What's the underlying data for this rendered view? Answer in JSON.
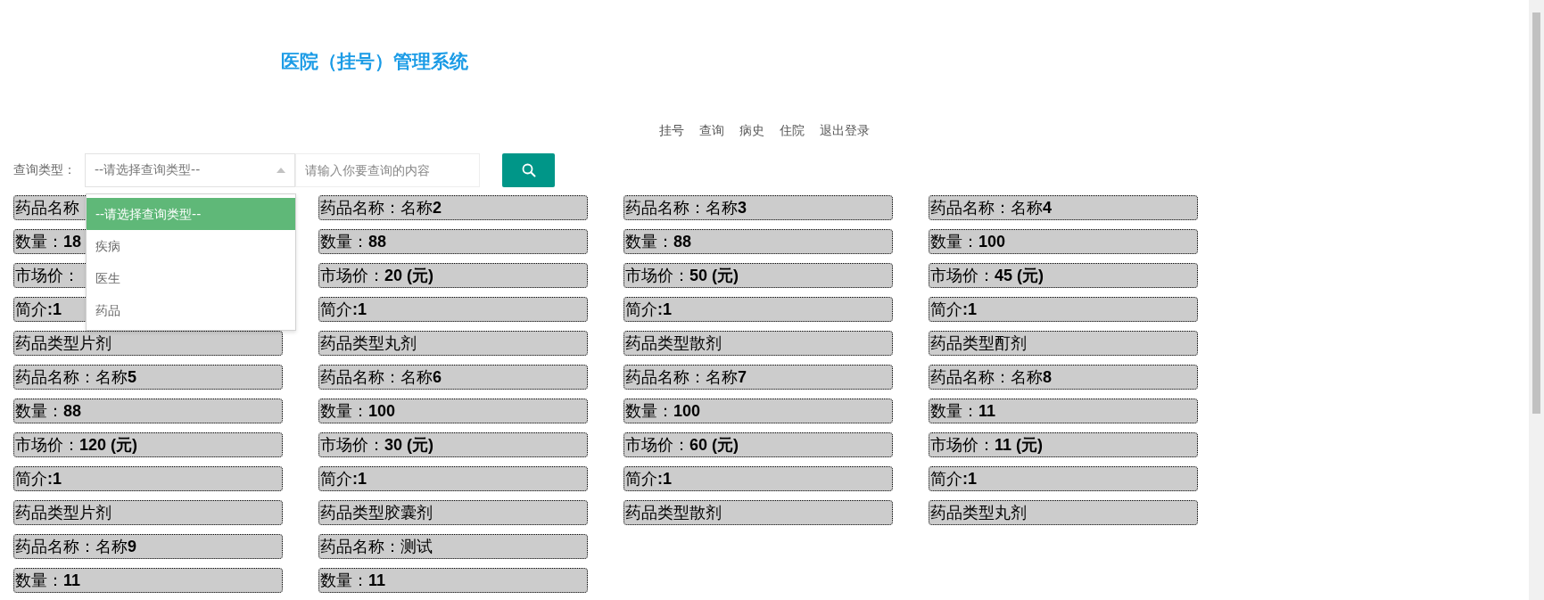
{
  "header": {
    "title": "医院（挂号）管理系统"
  },
  "nav": [
    {
      "label": "挂号"
    },
    {
      "label": "查询"
    },
    {
      "label": "病史"
    },
    {
      "label": "住院"
    },
    {
      "label": "退出登录"
    }
  ],
  "search": {
    "label": "查询类型：",
    "select": {
      "value": "--请选择查询类型--",
      "open": true,
      "options": [
        {
          "label": "--请选择查询类型--",
          "selected": true
        },
        {
          "label": "疾病",
          "selected": false
        },
        {
          "label": "医生",
          "selected": false
        },
        {
          "label": "药品",
          "selected": false
        }
      ]
    },
    "input": {
      "placeholder": "请输入你要查询的内容"
    }
  },
  "cards": [
    {
      "lines": [
        "药品名称",
        "数量：**18**",
        "市场价：",
        "简介**:1**",
        "药品类型片剂"
      ]
    },
    {
      "lines": [
        "药品名称：名称**2**",
        "数量：**88**",
        "市场价：**20 (元)**",
        "简介**:1**",
        "药品类型丸剂"
      ]
    },
    {
      "lines": [
        "药品名称：名称**3**",
        "数量：**88**",
        "市场价：**50 (元)**",
        "简介**:1**",
        "药品类型散剂"
      ]
    },
    {
      "lines": [
        "药品名称：名称**4**",
        "数量：**100**",
        "市场价：**45 (元)**",
        "简介**:1**",
        "药品类型酊剂"
      ]
    },
    {
      "lines": [
        "药品名称：名称**5**",
        "数量：**88**",
        "市场价：**120 (元)**",
        "简介**:1**",
        "药品类型片剂"
      ]
    },
    {
      "lines": [
        "药品名称：名称**6**",
        "数量：**100**",
        "市场价：**30 (元)**",
        "简介**:1**",
        "药品类型胶囊剂"
      ]
    },
    {
      "lines": [
        "药品名称：名称**7**",
        "数量：**100**",
        "市场价：**60 (元)**",
        "简介**:1**",
        "药品类型散剂"
      ]
    },
    {
      "lines": [
        "药品名称：名称**8**",
        "数量：**11**",
        "市场价：**11 (元)**",
        "简介**:1**",
        "药品类型丸剂"
      ]
    },
    {
      "lines": [
        "药品名称：名称**9**",
        "数量：**11**"
      ]
    },
    {
      "lines": [
        "药品名称：测试",
        "数量：**11**"
      ]
    }
  ]
}
